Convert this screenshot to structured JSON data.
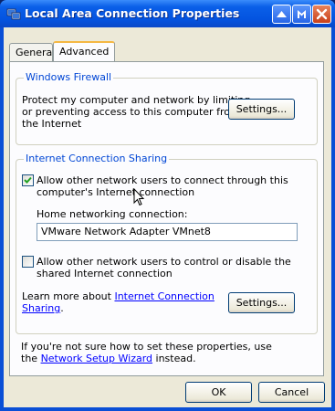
{
  "window": {
    "title": "Local Area Connection Properties",
    "title_icon": "network-connection-icon",
    "controls": [
      "minimize-icon",
      "help-icon",
      "close-icon"
    ]
  },
  "tabs": [
    {
      "label": "General",
      "active": false
    },
    {
      "label": "Advanced",
      "active": true
    }
  ],
  "firewall": {
    "title": "Windows Firewall",
    "text_line1": "Protect my computer and network by limiting",
    "text_line2": "or preventing access to this computer from",
    "text_line3": "the Internet",
    "settings_label": "Settings..."
  },
  "ics": {
    "title": "Internet Connection Sharing",
    "allow_connect_checked": true,
    "allow_connect_line1": "Allow other network users to connect through this",
    "allow_connect_line2": "computer's Internet connection",
    "home_net_label": "Home networking connection:",
    "home_net_value": "VMware Network Adapter VMnet8",
    "allow_control_checked": false,
    "allow_control_line1": "Allow other network users to control or disable the",
    "allow_control_line2": "shared Internet connection",
    "learn_prefix": "Learn more about ",
    "learn_link1": "Internet Connection",
    "learn_link2": "Sharing",
    "learn_suffix": ".",
    "settings_label": "Settings..."
  },
  "footer": {
    "line1": "If you're not sure how to set these properties, use",
    "line2_prefix": "the ",
    "wizard_link": "Network Setup Wizard",
    "line2_suffix": " instead."
  },
  "buttons": {
    "ok": "OK",
    "cancel": "Cancel"
  },
  "colors": {
    "titlebar": "#0a5fe8",
    "group_title": "#0046d5",
    "face": "#ece9d8",
    "link": "#0000ff"
  }
}
